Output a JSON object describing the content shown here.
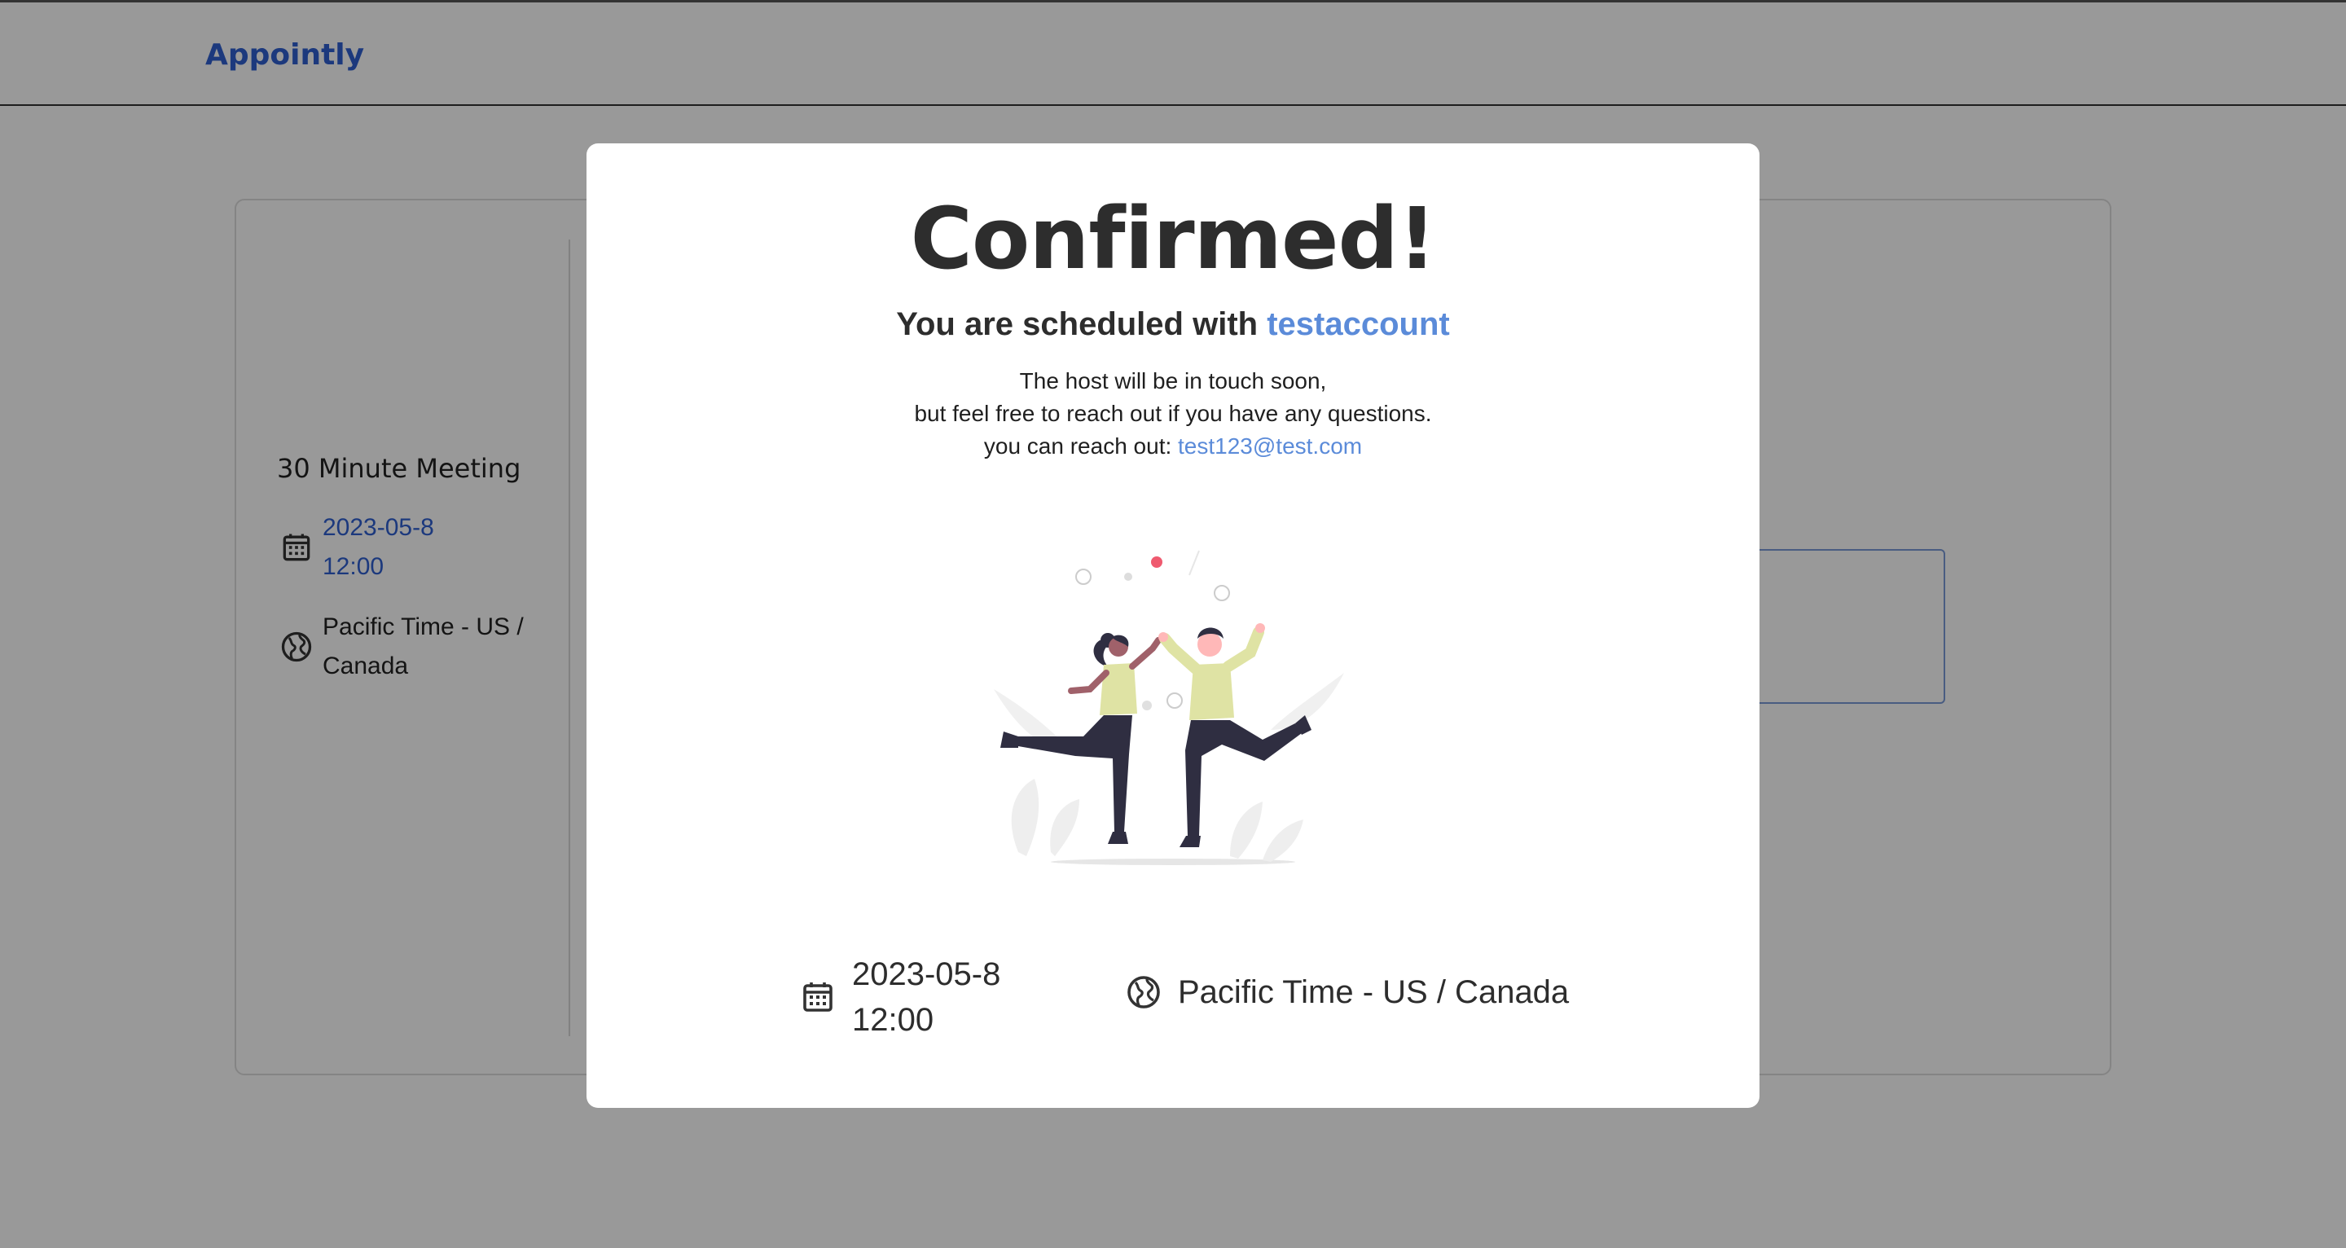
{
  "app": {
    "brand": "Appointly"
  },
  "sidebar": {
    "meeting_title": "30 Minute Meeting",
    "date": "2023-05-8",
    "time": "12:00",
    "timezone": "Pacific Time - US / Canada",
    "date_icon": "calendar-icon",
    "timezone_icon": "globe-icon"
  },
  "modal": {
    "title": "Confirmed!",
    "scheduled_prefix": "You are scheduled with",
    "host_name": "testaccount",
    "line1": "The host will be in touch soon,",
    "line2": "but feel free to reach out if you have any questions.",
    "reach_prefix": "you can reach out:",
    "email": "test123@test.com",
    "illustration": "celebration-high-five-illustration",
    "date": "2023-05-8",
    "time": "12:00",
    "timezone": "Pacific Time - US / Canada"
  },
  "colors": {
    "accent": "#2f5fd0",
    "link": "#5b8bd9",
    "overlay": "rgba(0,0,0,0.40)"
  }
}
